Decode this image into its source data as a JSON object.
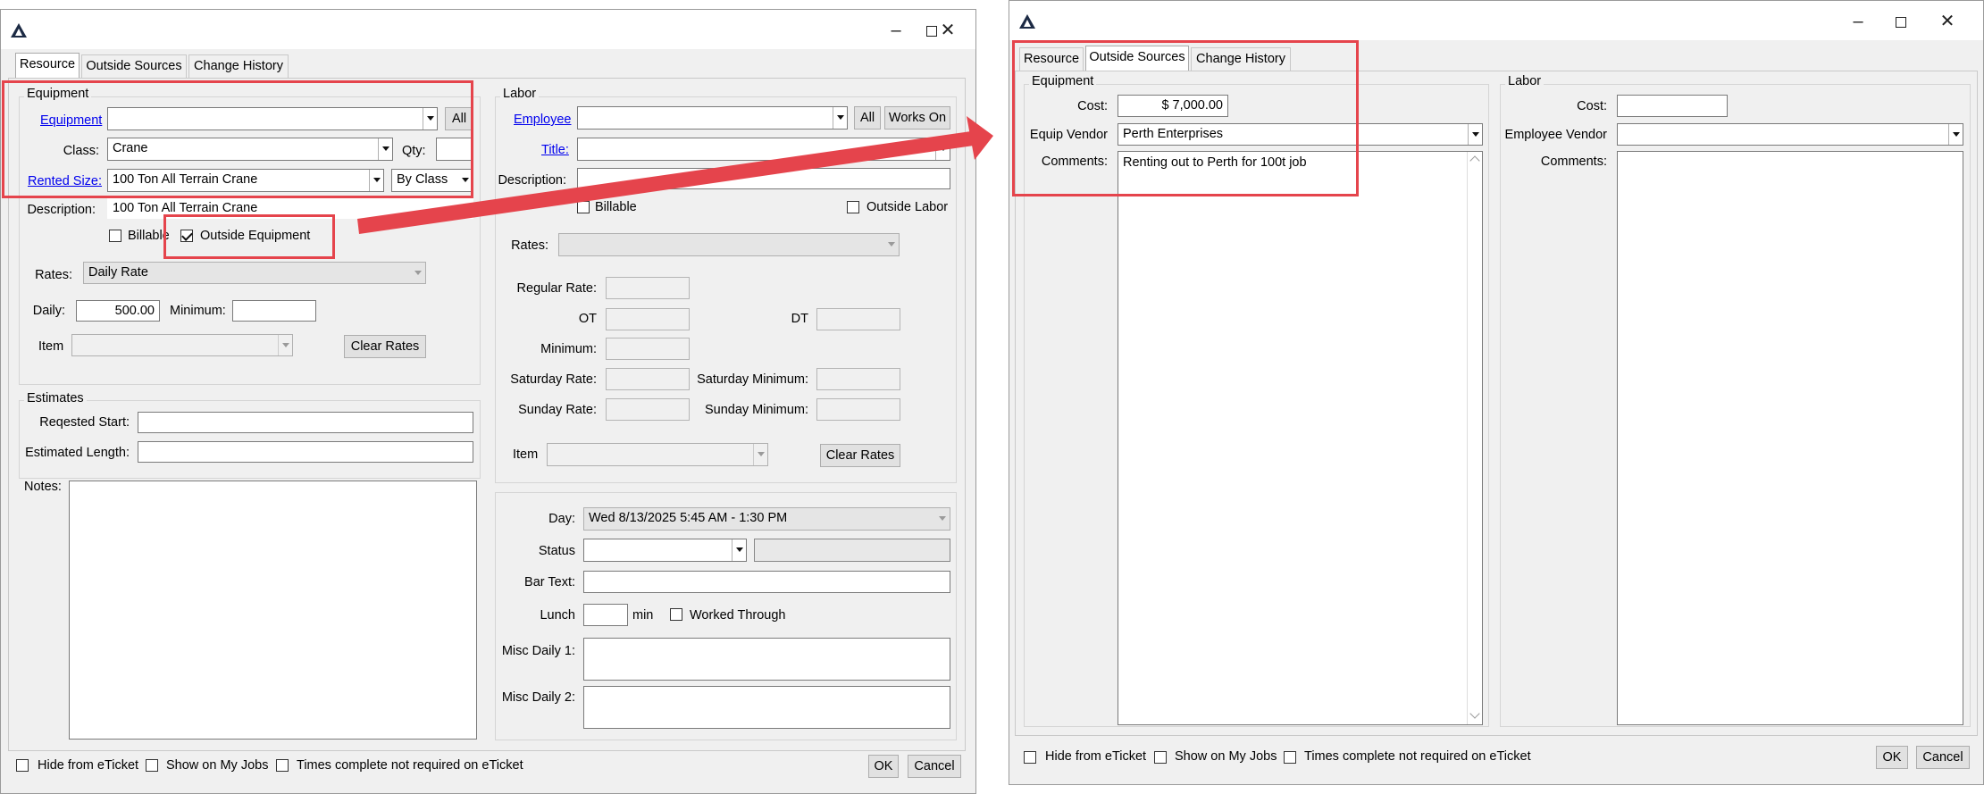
{
  "left": {
    "tabs": [
      "Resource",
      "Outside Sources",
      "Change History"
    ],
    "equipment": {
      "group": "Equipment",
      "equipment_link": "Equipment",
      "all_btn": "All",
      "class_label": "Class:",
      "class_value": "Crane",
      "qty_label": "Qty:",
      "rented_size_link": "Rented Size:",
      "rented_size_value": "100 Ton All Terrain Crane",
      "by_class": "By Class",
      "description_label": "Description:",
      "description_value": "100 Ton All Terrain Crane",
      "billable": "Billable",
      "outside_equipment": "Outside Equipment",
      "rates_label": "Rates:",
      "rates_value": "Daily Rate",
      "daily_label": "Daily:",
      "daily_value": "500.00",
      "minimum_label": "Minimum:",
      "item_label": "Item",
      "clear_rates": "Clear Rates"
    },
    "labor": {
      "group": "Labor",
      "employee_link": "Employee",
      "all_btn": "All",
      "works_on": "Works On",
      "title_link": "Title:",
      "description_label": "Description:",
      "billable": "Billable",
      "outside_labor": "Outside Labor",
      "rates_label": "Rates:",
      "regular_rate": "Regular Rate:",
      "ot": "OT",
      "dt": "DT",
      "minimum": "Minimum:",
      "saturday_rate": "Saturday Rate:",
      "saturday_minimum": "Saturday Minimum:",
      "sunday_rate": "Sunday Rate:",
      "sunday_minimum": "Sunday Minimum:",
      "item_label": "Item",
      "clear_rates": "Clear Rates"
    },
    "estimates": {
      "group": "Estimates",
      "requested_start": "Reqested Start:",
      "estimated_length": "Estimated Length:"
    },
    "notes_label": "Notes:",
    "schedule": {
      "day_label": "Day:",
      "day_value": "Wed 8/13/2025 5:45 AM - 1:30 PM",
      "status_label": "Status",
      "bar_text_label": "Bar Text:",
      "lunch_label": "Lunch",
      "min": "min",
      "worked_through": "Worked Through",
      "misc1": "Misc Daily 1:",
      "misc2": "Misc Daily 2:"
    },
    "footer": {
      "hide": "Hide from eTicket",
      "show": "Show on My Jobs",
      "times": "Times complete not required on eTicket",
      "ok": "OK",
      "cancel": "Cancel"
    }
  },
  "right": {
    "tabs": [
      "Resource",
      "Outside Sources",
      "Change History"
    ],
    "equipment": {
      "group": "Equipment",
      "cost_label": "Cost:",
      "cost_value": "$ 7,000.00",
      "vendor_label": "Equip Vendor",
      "vendor_value": "Perth Enterprises",
      "comments_label": "Comments:",
      "comments_value": "Renting out to Perth for 100t job"
    },
    "labor": {
      "group": "Labor",
      "cost_label": "Cost:",
      "vendor_label": "Employee Vendor",
      "comments_label": "Comments:"
    },
    "footer": {
      "hide": "Hide from eTicket",
      "show": "Show on My Jobs",
      "times": "Times complete not required on eTicket",
      "ok": "OK",
      "cancel": "Cancel"
    }
  },
  "colors": {
    "highlight": "#e5444c",
    "link": "#0000ee"
  }
}
